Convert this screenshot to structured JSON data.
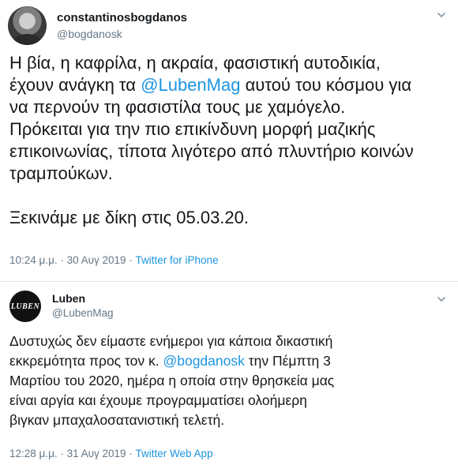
{
  "tweet1": {
    "display_name": "constantinosbogdanos",
    "handle": "@bogdanosk",
    "text_parts": {
      "p1": "Η βία, η καφρίλα, η ακραία, φασιστική αυτοδικία,\nέχουν ανάγκη τα ",
      "mention": "@LubenMag",
      "p2": " αυτού του κόσμου για\nνα περνούν τη φασιστίλα τους με χαμόγελο.\nΠρόκειται για την πιο επικίνδυνη μορφή μαζικής\nεπικοινωνίας, τίποτα λιγότερο από πλυντήριο κοινών\nτραμπούκων.\n\nΞεκινάμε με δίκη στις 05.03.20."
    },
    "timestamp": "10:24 μ.μ. · 30 Αυγ 2019 · ",
    "source": "Twitter for iPhone"
  },
  "tweet2": {
    "display_name": "Luben",
    "handle": "@LubenMag",
    "logo_text": "LUBEN",
    "text_parts": {
      "p1": "Δυστυχώς δεν είμαστε ενήμεροι για κάποια δικαστική\nεκκρεμότητα προς τον κ. ",
      "mention": "@bogdanosk",
      "p2": " την Πέμπτη 3\nΜαρτίου του 2020, ημέρα η οποία στην θρησκεία μας\nείναι αργία και έχουμε προγραμματίσει ολοήμερη\nβιγκαν μπαχαλοσατανιστική τελετή."
    },
    "timestamp": "12:28 μ.μ. · 31 Αυγ 2019 · ",
    "source": "Twitter Web App"
  },
  "colors": {
    "link": "#1b95e0",
    "secondary_text": "#657786",
    "primary_text": "#14171a",
    "divider": "#e1e8ed"
  },
  "icons": {
    "more": "chevron-down-icon"
  }
}
